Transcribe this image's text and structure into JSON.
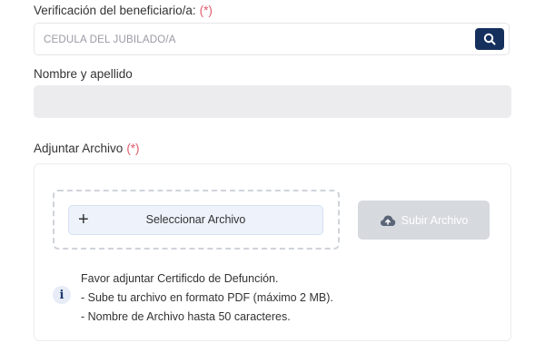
{
  "beneficiary": {
    "label": "Verificación del beneficiario/a:",
    "required_mark": "(*)",
    "placeholder": "CÉDULA DEL JUBILADO/A",
    "value": "",
    "search_icon": "search-icon"
  },
  "name": {
    "label": "Nombre y apellido",
    "value": ""
  },
  "attachment": {
    "label": "Adjuntar Archivo",
    "required_mark": "(*)",
    "select_icon": "plus-icon",
    "select_label": "Seleccionar Archivo",
    "upload_icon": "cloud-upload-icon",
    "upload_label": "Subir Archivo",
    "info_icon": "info-icon",
    "info_lines": [
      "Favor adjuntar Certificdo de Defunción.",
      "- Sube tu archivo en formato PDF (máximo 2 MB).",
      "- Nombre de Archivo hasta 50 caracteres."
    ]
  },
  "colors": {
    "required": "#e05a6a",
    "search_button": "#16305e",
    "upload_button_disabled": "#d6d9de",
    "select_button": "#edf2fb"
  }
}
